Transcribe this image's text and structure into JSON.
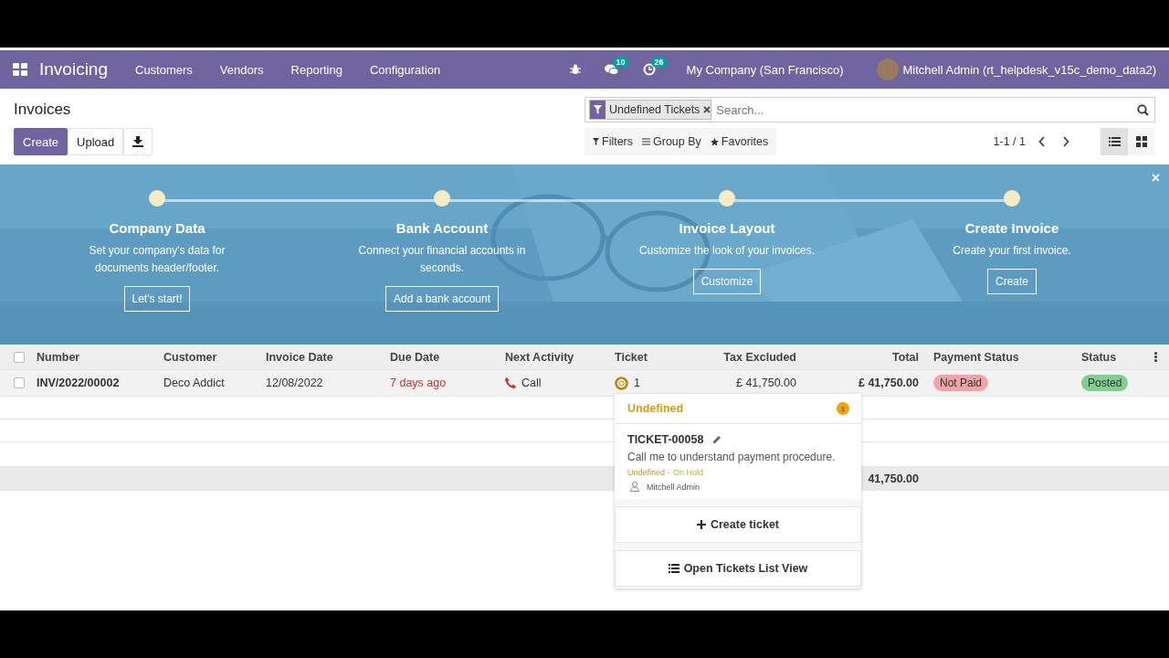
{
  "navbar": {
    "app_name": "Invoicing",
    "menu": [
      "Customers",
      "Vendors",
      "Reporting",
      "Configuration"
    ],
    "messages_count": "10",
    "activities_count": "26",
    "company": "My Company (San Francisco)",
    "user": "Mitchell Admin (rt_helpdesk_v15c_demo_data2)"
  },
  "control_panel": {
    "title": "Invoices",
    "buttons": [
      "Create",
      "Upload"
    ],
    "facet": "Undefined Tickets",
    "search": {
      "placeholder": "Search..."
    },
    "filters": [
      "Filters",
      "Group By",
      "Favorites"
    ],
    "pager": "1-1 / 1",
    "views": [
      {
        "kind": "list",
        "selected": true
      },
      {
        "kind": "kanban",
        "selected": false
      }
    ]
  },
  "onboarding": {
    "steps": [
      {
        "title": "Company Data",
        "text": "Set your company's data for documents header/footer.",
        "button": "Let's start!"
      },
      {
        "title": "Bank Account",
        "text": "Connect your financial accounts in seconds.",
        "button": "Add a bank account"
      },
      {
        "title": "Invoice Layout",
        "text": "Customize the look of your invoices.",
        "button": "Customize"
      },
      {
        "title": "Create Invoice",
        "text": "Create your first invoice.",
        "button": "Create"
      }
    ],
    "close": "×"
  },
  "table": {
    "select_all_checked": false,
    "columns": [
      "Number",
      "Customer",
      "Invoice Date",
      "Due Date",
      "Next Activity",
      "Ticket",
      "Tax Excluded",
      "Total",
      "Payment Status",
      "Status"
    ],
    "rows": [
      {
        "checked": false,
        "number": "INV/2022/00002",
        "customer": "Deco Addict",
        "invoice_date": "12/08/2022",
        "due_date": "7 days ago",
        "next_activity": "Call",
        "ticket": "1",
        "tax_excluded": "£ 41,750.00",
        "total": "£ 41,750.00",
        "payment_status": "Not Paid",
        "status": "Posted"
      }
    ],
    "totals": {
      "total": "41,750.00"
    }
  },
  "ticket_popup": {
    "group": "Undefined",
    "group_count": "1",
    "tickets": [
      {
        "name": "TICKET-00058",
        "description": "Call me to understand payment procedure.",
        "team": "Undefined",
        "separator": "-",
        "stage": "On Hold",
        "assignee": "Mitchell Admin"
      }
    ],
    "actions": [
      "Create ticket",
      "Open Tickets List View"
    ]
  }
}
